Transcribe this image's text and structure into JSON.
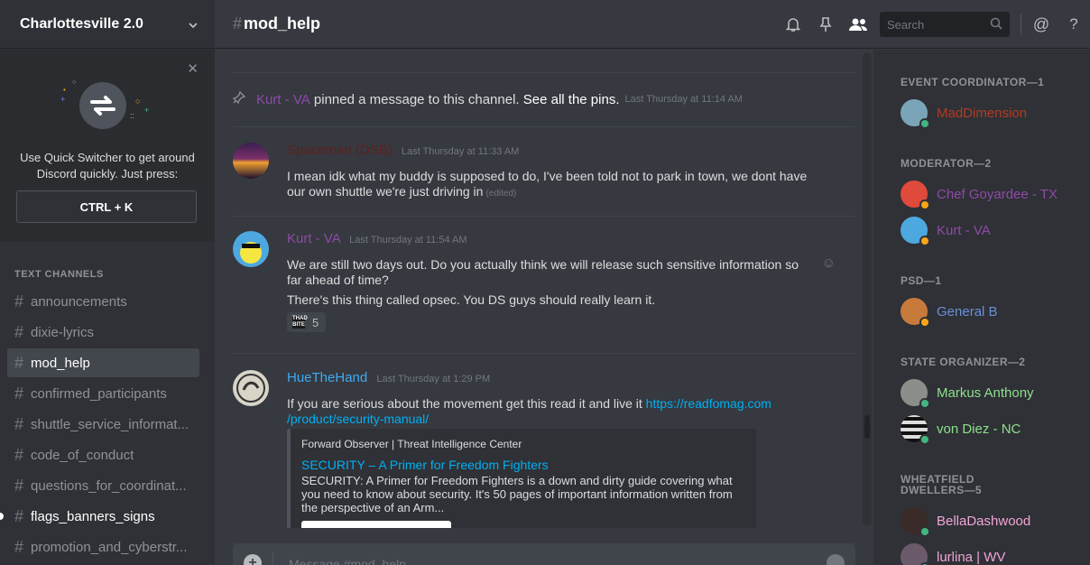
{
  "guild": {
    "name": "Charlottesville 2.0"
  },
  "quick_switcher": {
    "text_line1": "Use Quick Switcher to get around",
    "text_line2": "Discord quickly. Just press:",
    "shortcut": "CTRL + K"
  },
  "sidebar": {
    "section_title": "TEXT CHANNELS",
    "channels": [
      {
        "name": "announcements",
        "state": "normal"
      },
      {
        "name": "dixie-lyrics",
        "state": "normal"
      },
      {
        "name": "mod_help",
        "state": "active"
      },
      {
        "name": "confirmed_participants",
        "state": "normal"
      },
      {
        "name": "shuttle_service_informat...",
        "state": "normal"
      },
      {
        "name": "code_of_conduct",
        "state": "normal"
      },
      {
        "name": "questions_for_coordinat...",
        "state": "normal"
      },
      {
        "name": "flags_banners_signs",
        "state": "unread"
      },
      {
        "name": "promotion_and_cyberstr...",
        "state": "normal"
      }
    ]
  },
  "topbar": {
    "channel_name": "mod_help",
    "search_placeholder": "Search",
    "icons": [
      "bell-icon",
      "pin-icon",
      "members-icon",
      "search-icon",
      "at-icon",
      "help-icon"
    ]
  },
  "messages": {
    "pin_notice": {
      "author": "Kurt - VA",
      "text": " pinned a message to this channel. ",
      "link": "See all the pins.",
      "timestamp": "Last Thursday at 11:14 AM"
    },
    "items": [
      {
        "author": "Spaceman (DSB)",
        "author_color": "#5e1f1f",
        "timestamp": "Last Thursday at 11:33 AM",
        "lines": [
          "I mean idk what my buddy is supposed to do, I've been told not to park in town, we dont have",
          "our own shuttle we're just driving in"
        ],
        "edited": "(edited)"
      },
      {
        "author": "Kurt - VA",
        "author_color": "#8e4aa8",
        "timestamp": "Last Thursday at 11:54 AM",
        "lines": [
          "We are still two days out. Do you actually think we will release such sensitive information so",
          "far ahead of time?"
        ],
        "line2": "There's this thing called opsec. You DS guys should really learn it.",
        "reaction": {
          "emoji": "THAD BITE",
          "count": "5"
        }
      },
      {
        "author": "HueTheHand",
        "author_color": "#3fa9f5",
        "timestamp": "Last Thursday at 1:29 PM",
        "text": "If you are serious about the movement get this read it and live it ",
        "link_line1": "https://readfomag.com",
        "link_line2": "/product/security-manual/",
        "embed": {
          "provider": "Forward Observer | Threat Intelligence Center",
          "title": "SECURITY – A Primer for Freedom Fighters",
          "desc1": "SECURITY: A Primer for Freedom Fighters is a down and dirty guide covering what",
          "desc2": "you need to know about security.  It's 50 pages of important information written from",
          "desc3": "the perspective of an Arm..."
        }
      }
    ]
  },
  "input": {
    "placeholder": "Message #mod_help"
  },
  "members": {
    "groups": [
      {
        "title": "EVENT COORDINATOR—1"
      },
      {
        "title": "MODERATOR—2"
      },
      {
        "title": "PSD—1"
      },
      {
        "title": "STATE ORGANIZER—2"
      },
      {
        "title": "WHEATFIELD",
        "title2": "DWELLERS—5"
      }
    ],
    "list": [
      {
        "name": "MadDimension",
        "color": "#b53a22",
        "status": "#43b581"
      },
      {
        "name": "Chef Goyardee - TX",
        "color": "#8e4aa8",
        "status": "#faa61a"
      },
      {
        "name": "Kurt - VA",
        "color": "#8e4aa8",
        "status": "#faa61a"
      },
      {
        "name": "General B",
        "color": "#6a8fd8",
        "status": "#faa61a"
      },
      {
        "name": "Markus Anthony",
        "color": "#8ee08b",
        "status": "#43b581"
      },
      {
        "name": "von Diez - NC",
        "color": "#8ee08b",
        "status": "#43b581"
      },
      {
        "name": "BellaDashwood",
        "color": "#f0a5d6",
        "status": "#43b581"
      },
      {
        "name": "lurlina | WV",
        "color": "#f0a5d6",
        "status": "#43b581"
      }
    ]
  }
}
